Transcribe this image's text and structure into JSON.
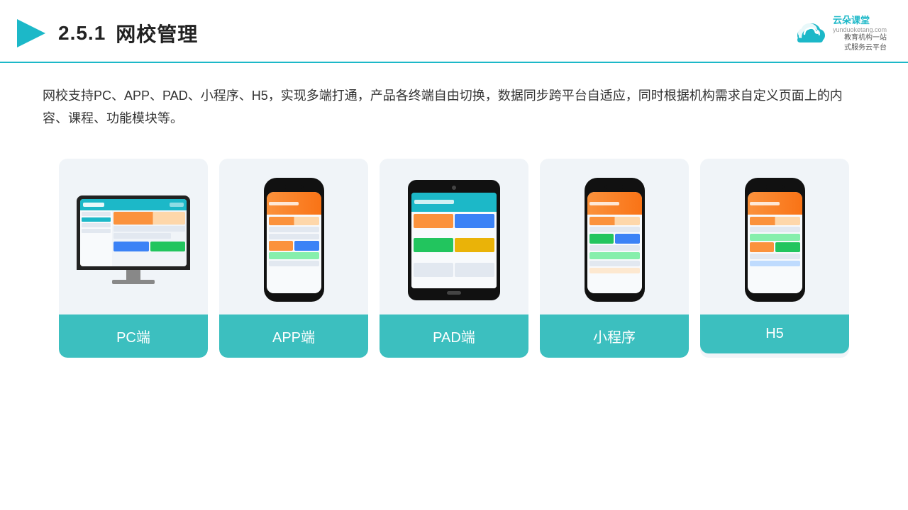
{
  "header": {
    "section_number": "2.5.1",
    "title": "网校管理",
    "brand_name": "云朵课堂",
    "brand_url": "yunduoketang.com",
    "brand_slogan": "教育机构一站\n式服务云平台"
  },
  "description": {
    "text": "网校支持PC、APP、PAD、小程序、H5，实现多端打通，产品各终端自由切换，数据同步跨平台自适应，同时根据机构需求自定义页面上的内容、课程、功能模块等。"
  },
  "cards": [
    {
      "id": "pc",
      "label": "PC端",
      "device": "monitor"
    },
    {
      "id": "app",
      "label": "APP端",
      "device": "phone-app"
    },
    {
      "id": "pad",
      "label": "PAD端",
      "device": "tablet"
    },
    {
      "id": "miniprogram",
      "label": "小程序",
      "device": "phone"
    },
    {
      "id": "h5",
      "label": "H5",
      "device": "phone-h5"
    }
  ],
  "colors": {
    "accent": "#1cb8c8",
    "teal": "#3cbfbf",
    "orange": "#fb923c",
    "bg_card": "#f0f4f8"
  }
}
